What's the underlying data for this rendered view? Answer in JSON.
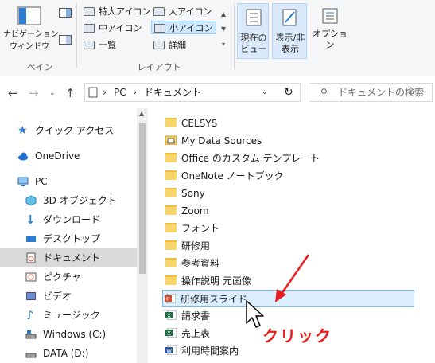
{
  "ribbon": {
    "nav_pane_label": "ナビゲーション\nウィンドウ",
    "pane_group_label": "ペイン",
    "layout_group_label": "レイアウト",
    "layout_options": [
      "特大アイコン",
      "大アイコン",
      "中アイコン",
      "小アイコン",
      "一覧",
      "詳細"
    ],
    "selected_layout": "小アイコン",
    "current_view_label": "現在の\nビュー",
    "show_hide_label": "表示/非\n表示",
    "options_label": "オプション"
  },
  "address": {
    "path": [
      "PC",
      "ドキュメント"
    ],
    "search_placeholder": "ドキュメントの検索"
  },
  "sidebar": {
    "items": [
      {
        "label": "クイック アクセス",
        "icon": "star-icon"
      },
      {
        "label": "OneDrive",
        "icon": "cloud-icon"
      },
      {
        "label": "PC",
        "icon": "computer-icon"
      },
      {
        "label": "3D オブジェクト",
        "icon": "cube-icon"
      },
      {
        "label": "ダウンロード",
        "icon": "download-icon"
      },
      {
        "label": "デスクトップ",
        "icon": "desktop-icon"
      },
      {
        "label": "ドキュメント",
        "icon": "documents-icon",
        "selected": true
      },
      {
        "label": "ピクチャ",
        "icon": "pictures-icon"
      },
      {
        "label": "ビデオ",
        "icon": "video-icon"
      },
      {
        "label": "ミュージック",
        "icon": "music-icon"
      },
      {
        "label": "Windows (C:)",
        "icon": "drive-icon"
      },
      {
        "label": "DATA (D:)",
        "icon": "drive-icon"
      }
    ]
  },
  "files": [
    {
      "name": "CELSYS",
      "type": "folder"
    },
    {
      "name": "My Data Sources",
      "type": "special-folder"
    },
    {
      "name": "Office のカスタム テンプレート",
      "type": "folder"
    },
    {
      "name": "OneNote ノートブック",
      "type": "folder"
    },
    {
      "name": "Sony",
      "type": "folder"
    },
    {
      "name": "Zoom",
      "type": "folder"
    },
    {
      "name": "フォント",
      "type": "folder"
    },
    {
      "name": "研修用",
      "type": "folder"
    },
    {
      "name": "参考資料",
      "type": "folder"
    },
    {
      "name": "操作説明 元画像",
      "type": "folder"
    },
    {
      "name": "研修用スライド",
      "type": "powerpoint",
      "highlighted": true
    },
    {
      "name": "請求書",
      "type": "excel"
    },
    {
      "name": "売上表",
      "type": "excel"
    },
    {
      "name": "利用時間案内",
      "type": "word"
    }
  ],
  "annotation": {
    "click_label": "クリック"
  },
  "colors": {
    "accent": "#0078d7",
    "annotation": "#e81c1c",
    "folder": "#f9d56e"
  }
}
